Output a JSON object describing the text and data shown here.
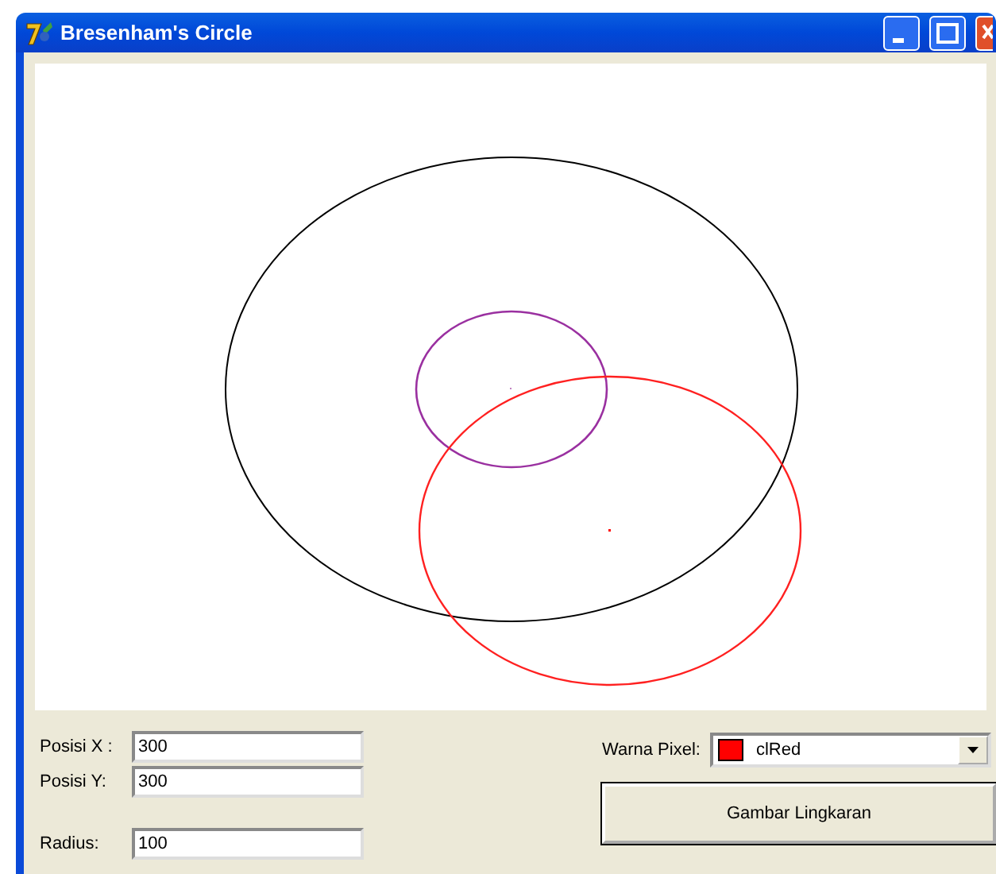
{
  "window": {
    "title": "Bresenham's Circle"
  },
  "fields": [
    {
      "label": "Posisi X :",
      "value": "300"
    },
    {
      "label": "Posisi Y:",
      "value": "300"
    },
    {
      "label": "Radius:",
      "value": "100"
    }
  ],
  "color_picker": {
    "label": "Warna Pixel:",
    "value": "clRed",
    "color": "#ff0000"
  },
  "buttons": [
    "Gambar Lingkaran"
  ]
}
